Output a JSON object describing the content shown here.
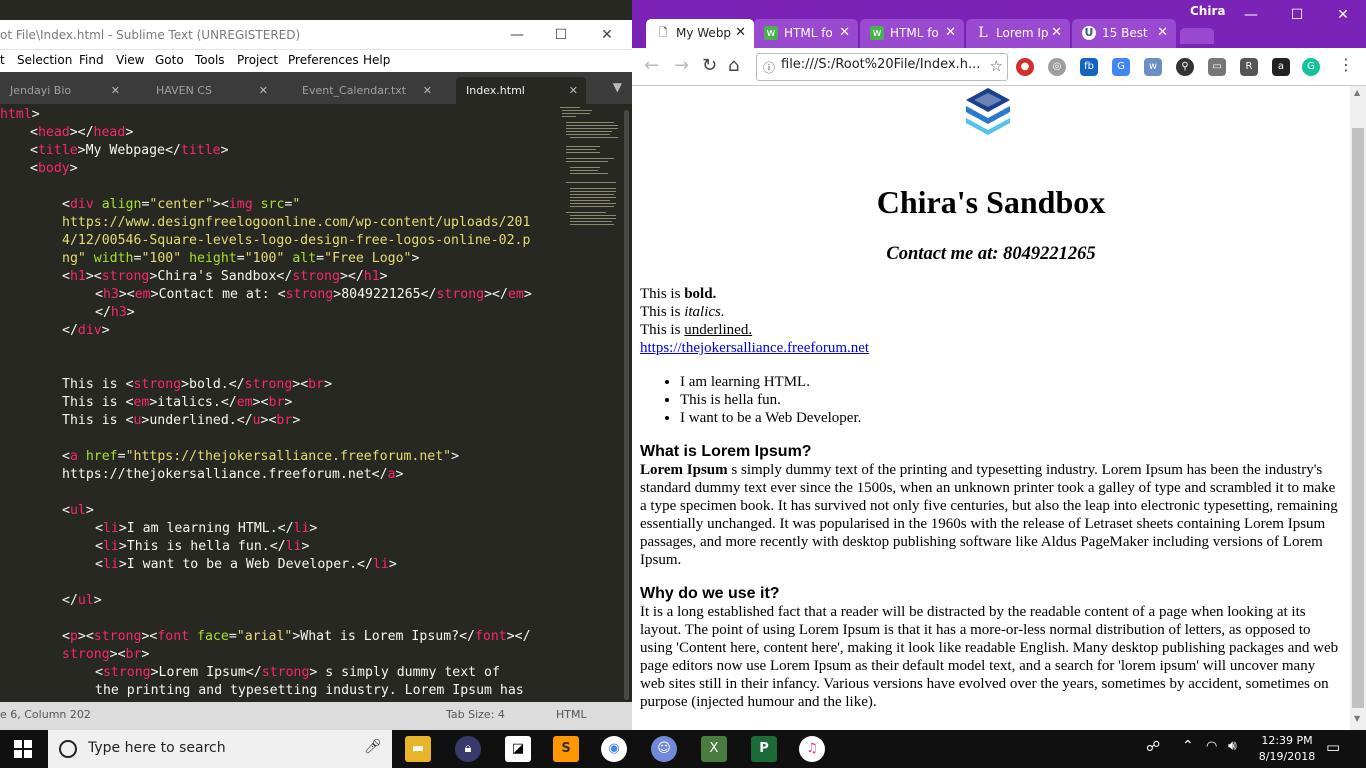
{
  "sublime": {
    "title": "ot File\\Index.html - Sublime Text (UNREGISTERED)",
    "menu": [
      "t",
      "Selection",
      "Find",
      "View",
      "Goto",
      "Tools",
      "Project",
      "Preferences",
      "Help"
    ],
    "tabs": [
      "Jendayi Bio",
      "HAVEN CS",
      "Event_Calendar.txt",
      "Index.html"
    ],
    "status_left": "e 6, Column 202",
    "tab_size": "Tab Size: 4",
    "syntax": "HTML"
  },
  "chrome": {
    "user": "Chira",
    "tabs": [
      {
        "label": "My Webp",
        "icon": "page-icon"
      },
      {
        "label": "HTML fo",
        "icon": "w3-icon"
      },
      {
        "label": "HTML fo",
        "icon": "w3-icon"
      },
      {
        "label": "Lorem Ip",
        "icon": "lorem-icon"
      },
      {
        "label": "15 Best",
        "icon": "shield-icon"
      }
    ],
    "url": "file:///S:/Root%20File/Index.h..."
  },
  "webpage": {
    "title": "Chira's Sandbox",
    "contact": "Contact me at: 8049221265",
    "bold_prefix": "This is ",
    "bold_word": "bold.",
    "italic_prefix": "This is ",
    "italic_word": "italics.",
    "underline_prefix": "This is ",
    "underline_word": "underlined.",
    "link": "https://thejokersalliance.freeforum.net",
    "list": [
      "I am learning HTML.",
      "This is hella fun.",
      "I want to be a Web Developer."
    ],
    "h_what": "What is Lorem Ipsum?",
    "what_strong": "Lorem Ipsum",
    "what_body": " s simply dummy text of the printing and typesetting industry. Lorem Ipsum has been the industry's standard dummy text ever since the 1500s, when an unknown printer took a galley of type and scrambled it to make a type specimen book. It has survived not only five centuries, but also the leap into electronic typesetting, remaining essentially unchanged. It was popularised in the 1960s with the release of Letraset sheets containing Lorem Ipsum passages, and more recently with desktop publishing software like Aldus PageMaker including versions of Lorem Ipsum.",
    "h_why": "Why do we use it?",
    "why_body": "It is a long established fact that a reader will be distracted by the readable content of a page when looking at its layout. The point of using Lorem Ipsum is that it has a more-or-less normal distribution of letters, as opposed to using 'Content here, content here', making it look like readable English. Many desktop publishing packages and web page editors now use Lorem Ipsum as their default model text, and a search for 'lorem ipsum' will uncover many web sites still in their infancy. Various versions have evolved over the years, sometimes by accident, sometimes on purpose (injected humour and the like)."
  },
  "taskbar": {
    "search_placeholder": "Type here to search",
    "time": "12:39 PM",
    "date": "8/19/2018"
  }
}
